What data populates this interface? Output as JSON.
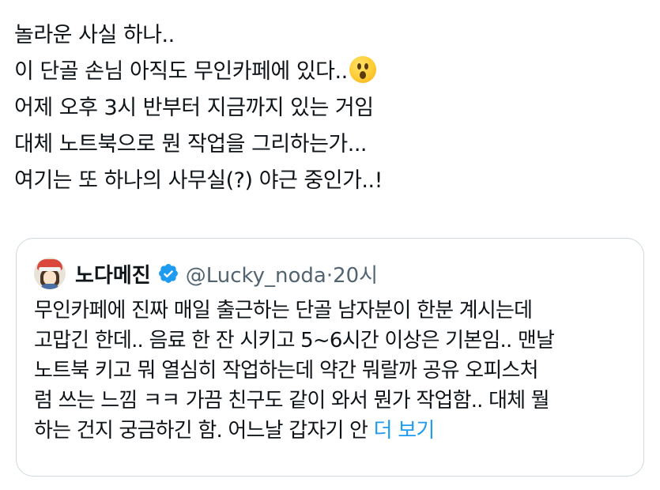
{
  "tweet": {
    "lines": [
      "놀라운 사실 하나..",
      "이 단골 손님 아직도 무인카페에 있다..",
      "어제 오후 3시 반부터 지금까지 있는 거임",
      "대체 노트북으로 뭔 작업을 그리하는가...",
      "여기는 또 하나의 사무실(?) 야근 중인가..!"
    ],
    "emoji": "hushed-face-emoji"
  },
  "quote": {
    "name": "노다메진",
    "handle": "@Lucky_noda",
    "separator": "·",
    "time": "20시",
    "verified_color": "#1d9bf0",
    "body_lines": [
      "무인카페에 진짜 매일 출근하는 단골 남자분이 한분 계시는데",
      "고맙긴 한데.. 음료 한 잔 시키고 5~6시간 이상은 기본임.. 맨날",
      "노트북 키고 뭐 열심히 작업하는데 약간 뭐랄까 공유 오피스처",
      "럼 쓰는 느낌 ㅋㅋ 가끔 친구도 같이 와서 뭔가 작업함.. 대체 뭘",
      "하는 건지 궁금하긴 함. 어느날 갑자기 안"
    ],
    "show_more": "더 보기",
    "link_color": "#1d9bf0"
  }
}
